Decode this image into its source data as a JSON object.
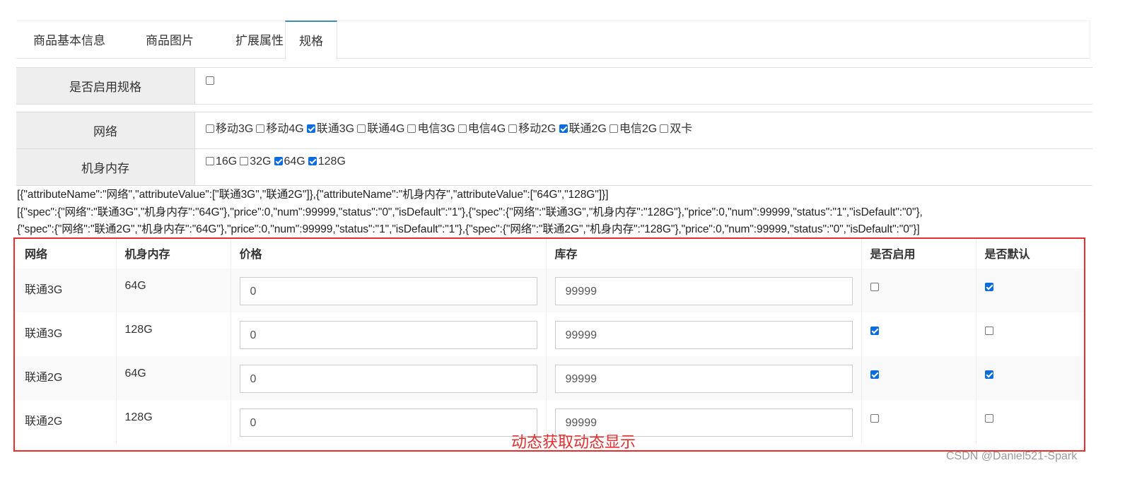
{
  "tabs": [
    {
      "label": "商品基本信息"
    },
    {
      "label": "商品图片"
    },
    {
      "label": "扩展属性"
    },
    {
      "label": "规格",
      "active": true
    }
  ],
  "enable_spec": {
    "label": "是否启用规格",
    "checked": false
  },
  "attributes": [
    {
      "label": "网络",
      "options": [
        {
          "label": "移动3G",
          "checked": false
        },
        {
          "label": "移动4G",
          "checked": false
        },
        {
          "label": "联通3G",
          "checked": true
        },
        {
          "label": "联通4G",
          "checked": false
        },
        {
          "label": "电信3G",
          "checked": false
        },
        {
          "label": "电信4G",
          "checked": false
        },
        {
          "label": "移动2G",
          "checked": false
        },
        {
          "label": "联通2G",
          "checked": true
        },
        {
          "label": "电信2G",
          "checked": false
        },
        {
          "label": "双卡",
          "checked": false
        }
      ]
    },
    {
      "label": "机身内存",
      "options": [
        {
          "label": "16G",
          "checked": false
        },
        {
          "label": "32G",
          "checked": false
        },
        {
          "label": "64G",
          "checked": true
        },
        {
          "label": "128G",
          "checked": true
        }
      ]
    }
  ],
  "json_lines": [
    "[{\"attributeName\":\"网络\",\"attributeValue\":[\"联通3G\",\"联通2G\"]},{\"attributeName\":\"机身内存\",\"attributeValue\":[\"64G\",\"128G\"]}]",
    "[{\"spec\":{\"网络\":\"联通3G\",\"机身内存\":\"64G\"},\"price\":0,\"num\":99999,\"status\":\"0\",\"isDefault\":\"1\"},{\"spec\":{\"网络\":\"联通3G\",\"机身内存\":\"128G\"},\"price\":0,\"num\":99999,\"status\":\"1\",\"isDefault\":\"0\"},",
    "{\"spec\":{\"网络\":\"联通2G\",\"机身内存\":\"64G\"},\"price\":0,\"num\":99999,\"status\":\"1\",\"isDefault\":\"1\"},{\"spec\":{\"网络\":\"联通2G\",\"机身内存\":\"128G\"},\"price\":0,\"num\":99999,\"status\":\"0\",\"isDefault\":\"0\"}]"
  ],
  "sku_table": {
    "headers": {
      "network": "网络",
      "memory": "机身内存",
      "price": "价格",
      "stock": "库存",
      "enabled": "是否启用",
      "default": "是否默认"
    },
    "rows": [
      {
        "network": "联通3G",
        "memory": "64G",
        "price": "0",
        "stock": "99999",
        "enabled": false,
        "default": true
      },
      {
        "network": "联通3G",
        "memory": "128G",
        "price": "0",
        "stock": "99999",
        "enabled": true,
        "default": false
      },
      {
        "network": "联通2G",
        "memory": "64G",
        "price": "0",
        "stock": "99999",
        "enabled": true,
        "default": true
      },
      {
        "network": "联通2G",
        "memory": "128G",
        "price": "0",
        "stock": "99999",
        "enabled": false,
        "default": false
      }
    ]
  },
  "annotation": "动态获取动态显示",
  "watermark": "CSDN @Daniel521-Spark",
  "colors": {
    "accent": "#3c8dbc",
    "annotation": "#e62e2e",
    "checkbox_on": "#0b6cde"
  }
}
